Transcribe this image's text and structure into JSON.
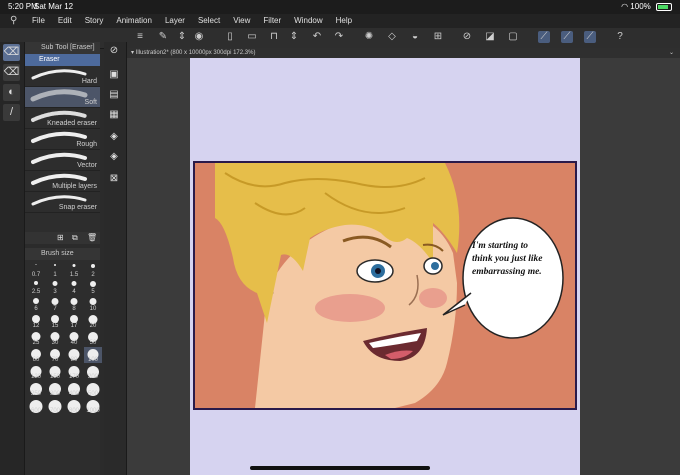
{
  "status": {
    "time": "5:20 PM",
    "date": "Sat Mar 12",
    "battery": "100%"
  },
  "menu": {
    "items": [
      "File",
      "Edit",
      "Story",
      "Animation",
      "Layer",
      "Select",
      "View",
      "Filter",
      "Window",
      "Help"
    ]
  },
  "subtool": {
    "title": "Sub Tool [Eraser]",
    "tab": "Eraser",
    "brushes": [
      "Hard",
      "Soft",
      "Kneaded eraser",
      "Rough",
      "Vector",
      "Multiple layers",
      "Snap eraser"
    ],
    "selected": "Soft"
  },
  "brushsize": {
    "title": "Brush size",
    "sizes": [
      "0.7",
      "1",
      "1.5",
      "2",
      "2.5",
      "3",
      "4",
      "5",
      "6",
      "7",
      "8",
      "10",
      "12",
      "15",
      "17",
      "20",
      "25",
      "30",
      "40",
      "50",
      "60",
      "70",
      "80",
      "100",
      "120",
      "150",
      "170",
      "200",
      "250",
      "300",
      "400",
      "500",
      "600",
      "700",
      "800",
      "1000"
    ],
    "selected": "100"
  },
  "document": {
    "tab": "Illustration2* (800 x 10000px 300dpi 172.3%)"
  },
  "speech": {
    "text": "I'm starting to think you just like embarrassing me."
  },
  "colors": {
    "accent": "#4d6a9c",
    "panel_bg": "#d98365",
    "canvas_bg": "#d6d3f0",
    "border": "#2a1a4a"
  }
}
